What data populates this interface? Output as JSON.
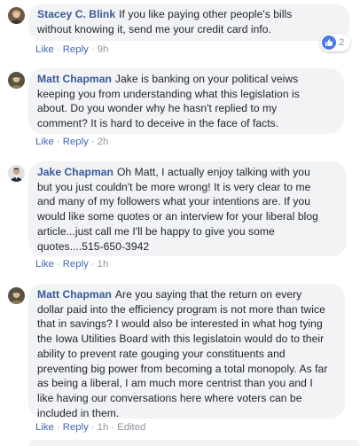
{
  "comments": [
    {
      "author": "Stacey C. Blink",
      "text": "If you like paying other people's bills\nwithout knowing it, send me your credit card info.",
      "actions": [
        "Like",
        "Reply"
      ],
      "time": "9h",
      "reactions": {
        "icon": "thumbs-up-icon",
        "count": "2"
      }
    },
    {
      "author": "Matt Chapman",
      "text": "Jake is banking on your political veiws\nkeeping you from understanding what this legislation is\nabout. Do you wonder why he hasn't replied to my\ncomment? It is hard to deceive in the face of facts.",
      "actions": [
        "Like",
        "Reply"
      ],
      "time": "2h"
    },
    {
      "author": "Jake Chapman",
      "text": "Oh Matt, I actually enjoy talking with you\nbut you just couldn't be more wrong! It is very clear to me\nand many of my followers what your intentions are. If you\nwould like some quotes or an interview for your liberal blog\narticle...just call me I'll be happy to give you some\nquotes....515-650-3942",
      "actions": [
        "Like",
        "Reply"
      ],
      "time": "1h"
    },
    {
      "author": "Matt Chapman",
      "text": "Are you saying that the return on every\ndollar paid into the efficiency program is not more than twice\nthat in savings? I would also be interested in what hog tying\nthe Iowa Utilities Board with this legislatoin would do to their\nability to prevent rate gouging your constituents and\npreventing big power from becoming a total monopoly. As far\nas being a liberal, I am much more centrist than you and I\nlike having our conversations here where voters can be\nincluded in them.",
      "actions": [
        "Like",
        "Reply"
      ],
      "time": "1h",
      "edited": "Edited"
    }
  ],
  "colors": {
    "author": "#385898",
    "bubble": "#f2f3f5",
    "action": "#4267b2",
    "meta": "#90949c",
    "like_badge": "#4a79e8"
  }
}
